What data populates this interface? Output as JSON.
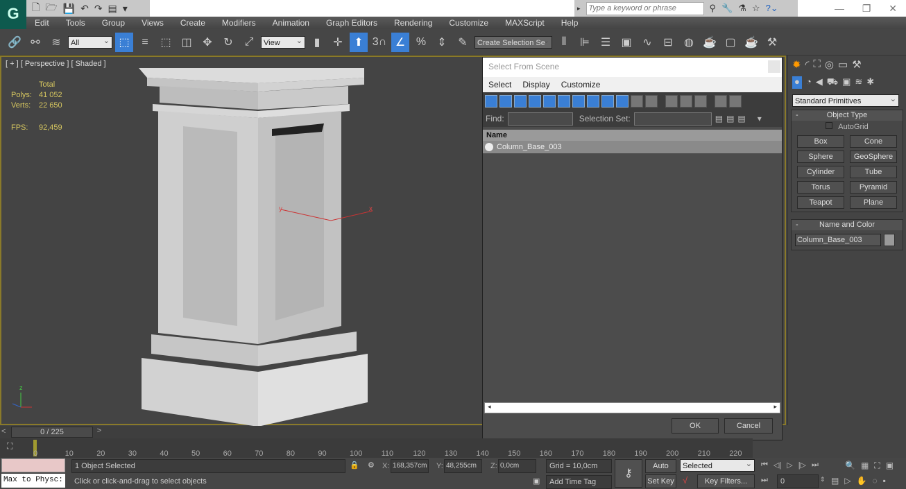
{
  "app": {
    "logo": "3ds-max-logo",
    "quick_access": [
      "new-icon",
      "open-icon",
      "save-icon",
      "undo-icon",
      "redo-icon",
      "project-icon"
    ]
  },
  "search": {
    "placeholder": "Type a keyword or phrase"
  },
  "menu": [
    "Edit",
    "Tools",
    "Group",
    "Views",
    "Create",
    "Modifiers",
    "Animation",
    "Graph Editors",
    "Rendering",
    "Customize",
    "MAXScript",
    "Help"
  ],
  "toolbar": {
    "filter": "All",
    "ref_coord": "View",
    "selection_set": "Create Selection Se",
    "snap_label": "3"
  },
  "viewport": {
    "label": "[ + ] [ Perspective ] [ Shaded ]",
    "stats_header": "Total",
    "polys_label": "Polys:",
    "polys": "41 052",
    "verts_label": "Verts:",
    "verts": "22 650",
    "fps_label": "FPS:",
    "fps": "92,459",
    "axis_x": "x",
    "axis_y": "y",
    "axis_z": "z",
    "border_color": "#8a7a2a"
  },
  "dialog": {
    "title": "Select From Scene",
    "menu": [
      "Select",
      "Display",
      "Customize"
    ],
    "find_label": "Find:",
    "find_value": "",
    "selset_label": "Selection Set:",
    "column_name": "Name",
    "rows": [
      {
        "name": "Column_Base_003"
      }
    ],
    "ok": "OK",
    "cancel": "Cancel"
  },
  "command_panel": {
    "category": "Standard Primitives",
    "object_type_title": "Object Type",
    "autogrid": "AutoGrid",
    "autogrid_checked": false,
    "buttons": [
      "Box",
      "Cone",
      "Sphere",
      "GeoSphere",
      "Cylinder",
      "Tube",
      "Torus",
      "Pyramid",
      "Teapot",
      "Plane"
    ],
    "name_color_title": "Name and Color",
    "object_name": "Column_Base_003",
    "object_color": "#9a9a9a"
  },
  "timeline": {
    "frame": "0 / 225",
    "ticks": [
      "0",
      "10",
      "20",
      "30",
      "40",
      "50",
      "60",
      "70",
      "80",
      "90",
      "100",
      "110",
      "120",
      "130",
      "140",
      "150",
      "160",
      "170",
      "180",
      "190",
      "200",
      "210",
      "220"
    ]
  },
  "status": {
    "maxscript": "Max to Physc:",
    "selected": "1 Object Selected",
    "prompt": "Click or click-and-drag to select objects",
    "x_label": "X:",
    "x": "168,357cm",
    "y_label": "Y:",
    "y": "48,255cm",
    "z_label": "Z:",
    "z": "0,0cm",
    "grid": "Grid = 10,0cm",
    "add_time_tag": "Add Time Tag",
    "auto_key": "Auto Key",
    "set_key": "Set Key",
    "key_mode": "Selected",
    "key_filters": "Key Filters...",
    "current_frame": "0"
  },
  "colors": {
    "accent": "#3a7fd5",
    "stat": "#d8c860"
  }
}
